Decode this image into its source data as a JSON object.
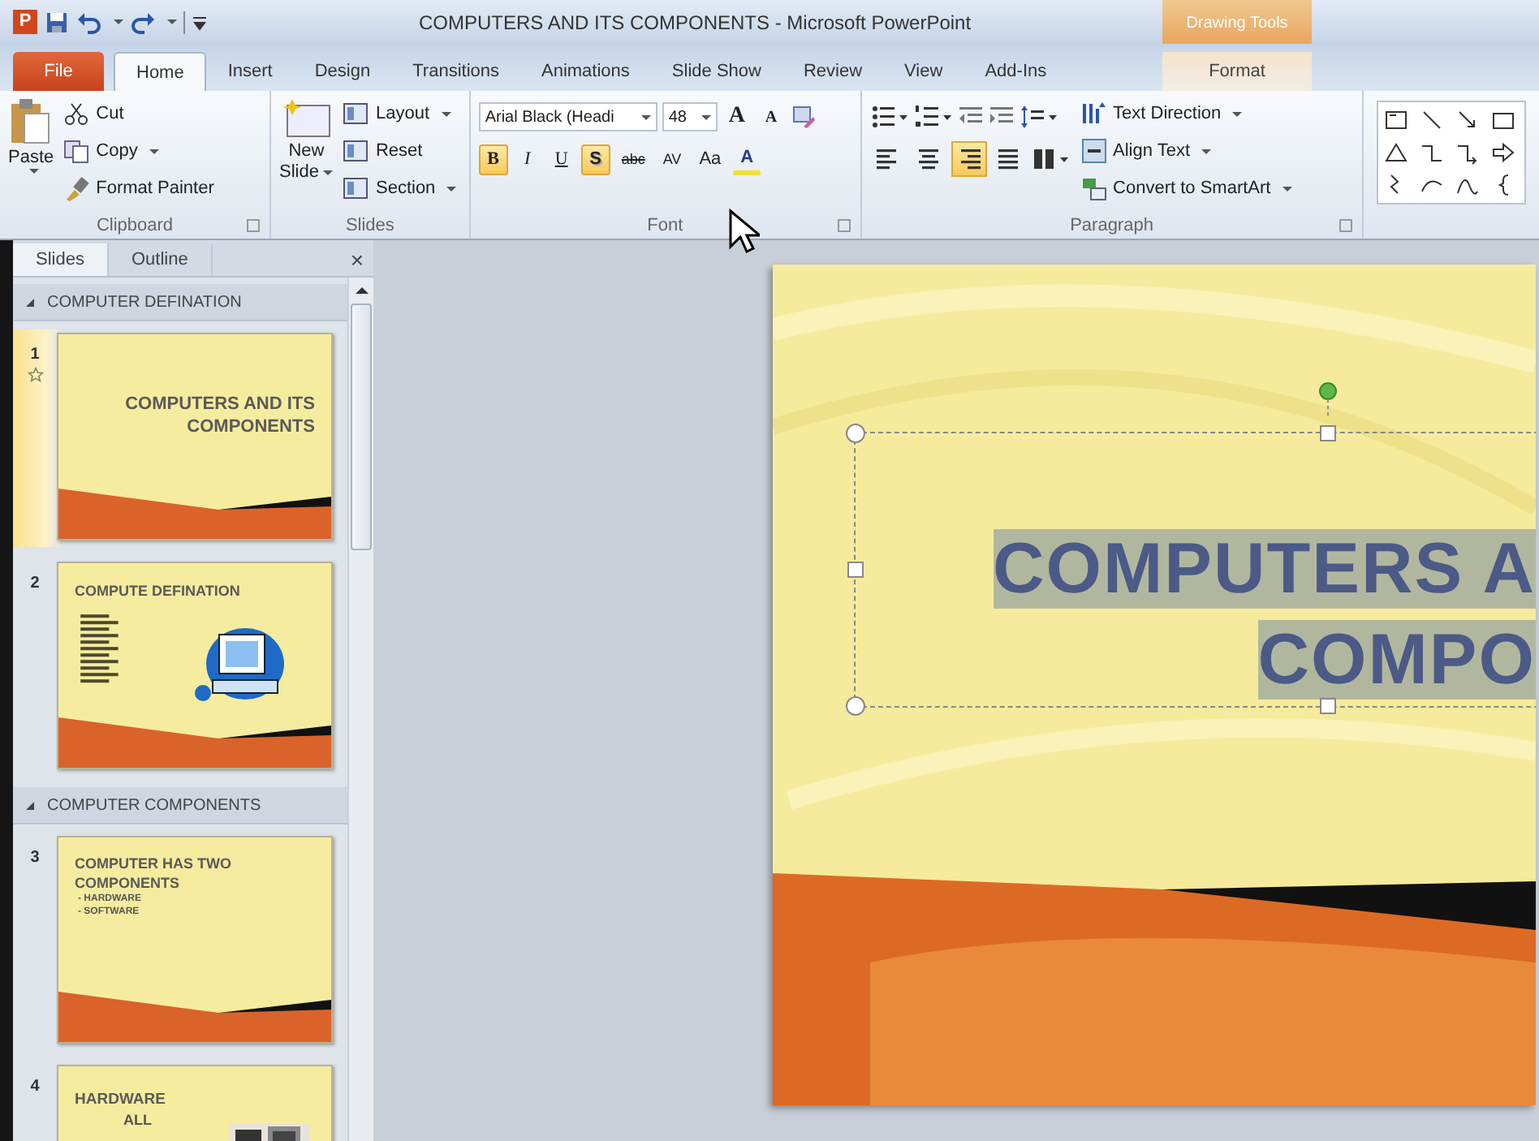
{
  "title_bar": {
    "app_logo": "P",
    "title": "COMPUTERS AND ITS COMPONENTS - Microsoft PowerPoint",
    "contextual_group": "Drawing Tools"
  },
  "tabs": [
    {
      "label": "File",
      "kind": "file",
      "selected": false
    },
    {
      "label": "Home",
      "kind": "normal",
      "selected": true
    },
    {
      "label": "Insert",
      "kind": "normal",
      "selected": false
    },
    {
      "label": "Design",
      "kind": "normal",
      "selected": false
    },
    {
      "label": "Transitions",
      "kind": "normal",
      "selected": false
    },
    {
      "label": "Animations",
      "kind": "normal",
      "selected": false
    },
    {
      "label": "Slide Show",
      "kind": "normal",
      "selected": false
    },
    {
      "label": "Review",
      "kind": "normal",
      "selected": false
    },
    {
      "label": "View",
      "kind": "normal",
      "selected": false
    },
    {
      "label": "Add-Ins",
      "kind": "normal",
      "selected": false
    },
    {
      "label": "Format",
      "kind": "contextual",
      "selected": false
    }
  ],
  "ribbon": {
    "clipboard": {
      "label": "Clipboard",
      "paste": "Paste",
      "items": [
        {
          "label": "Cut",
          "dropdown": false
        },
        {
          "label": "Copy",
          "dropdown": true
        },
        {
          "label": "Format Painter",
          "dropdown": false
        }
      ]
    },
    "slides": {
      "label": "Slides",
      "new_slide": [
        "New",
        "Slide"
      ],
      "items": [
        {
          "label": "Layout",
          "dropdown": true
        },
        {
          "label": "Reset",
          "dropdown": false
        },
        {
          "label": "Section",
          "dropdown": true
        }
      ]
    },
    "font": {
      "label": "Font",
      "font_name": "Arial Black (Headi",
      "font_size": "48",
      "size_buttons": [
        "A",
        "A"
      ],
      "format_buttons": [
        {
          "text": "B",
          "kind": "bold",
          "selected": true
        },
        {
          "text": "I",
          "kind": "italic",
          "selected": false
        },
        {
          "text": "U",
          "kind": "underline",
          "selected": false
        },
        {
          "text": "S",
          "kind": "shadow",
          "selected": true
        },
        {
          "text": "abc",
          "kind": "strike",
          "selected": false
        },
        {
          "text": "AV",
          "kind": "spacing",
          "selected": false
        },
        {
          "text": "Aa",
          "kind": "case",
          "selected": false
        },
        {
          "text": "A",
          "kind": "color",
          "selected": false
        }
      ]
    },
    "paragraph": {
      "label": "Paragraph",
      "alignment": [
        {
          "kind": "left",
          "selected": false
        },
        {
          "kind": "center",
          "selected": false
        },
        {
          "kind": "right",
          "selected": true
        },
        {
          "kind": "justify",
          "selected": false
        }
      ],
      "commands": [
        {
          "label": "Text Direction"
        },
        {
          "label": "Align Text"
        },
        {
          "label": "Convert to SmartArt"
        }
      ]
    }
  },
  "slides_pane": {
    "tabs": [
      {
        "label": "Slides",
        "selected": true
      },
      {
        "label": "Outline",
        "selected": false
      }
    ],
    "close": "×",
    "sections": [
      {
        "title": "COMPUTER DEFINATION",
        "slides": [
          {
            "number": "1",
            "selected": true,
            "has_transition": true,
            "kind": "title",
            "title_lines": [
              "COMPUTERS AND ITS",
              "COMPONENTS"
            ]
          },
          {
            "number": "2",
            "selected": false,
            "has_transition": false,
            "kind": "definition",
            "title_lines": [
              "COMPUTE DEFINATION"
            ]
          }
        ]
      },
      {
        "title": "COMPUTER COMPONENTS",
        "slides": [
          {
            "number": "3",
            "selected": false,
            "has_transition": false,
            "kind": "bullets",
            "title_lines": [
              "COMPUTER HAS TWO",
              "COMPONENTS"
            ],
            "bullets": [
              "- HARDWARE",
              "- SOFTWARE"
            ]
          },
          {
            "number": "4",
            "selected": false,
            "has_transition": false,
            "kind": "picture",
            "title_lines": [
              "HARDWARE"
            ],
            "bullets": [
              "ALL"
            ]
          }
        ]
      }
    ]
  },
  "slide": {
    "title_lines": [
      "COMPUTERS A",
      "COMPO"
    ],
    "text_selected": true
  }
}
